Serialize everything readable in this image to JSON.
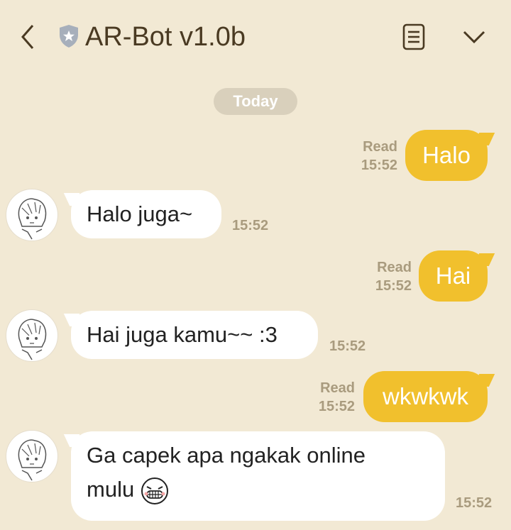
{
  "header": {
    "title": "AR-Bot v1.0b"
  },
  "date_label": "Today",
  "messages": {
    "m1": {
      "text": "Halo",
      "read": "Read",
      "time": "15:52"
    },
    "m2": {
      "text": "Halo juga~",
      "time": "15:52"
    },
    "m3": {
      "text": "Hai",
      "read": "Read",
      "time": "15:52"
    },
    "m4": {
      "text": "Hai juga kamu~~ :3",
      "time": "15:52"
    },
    "m5": {
      "text": "wkwkwk",
      "read": "Read",
      "time": "15:52"
    },
    "m6": {
      "line1": "Ga capek apa ngakak online",
      "line2": "mulu",
      "time": "15:52"
    }
  },
  "colors": {
    "background": "#f2e9d4",
    "outgoing_bubble": "#f1c02d",
    "incoming_bubble": "#ffffff",
    "meta_text": "#a99b7e",
    "title_text": "#4a3a22"
  },
  "icons": {
    "back": "chevron-left-icon",
    "verified": "shield-star-icon",
    "menu": "document-menu-icon",
    "expand": "chevron-down-icon",
    "emoji": "grinning-emoji-icon"
  }
}
